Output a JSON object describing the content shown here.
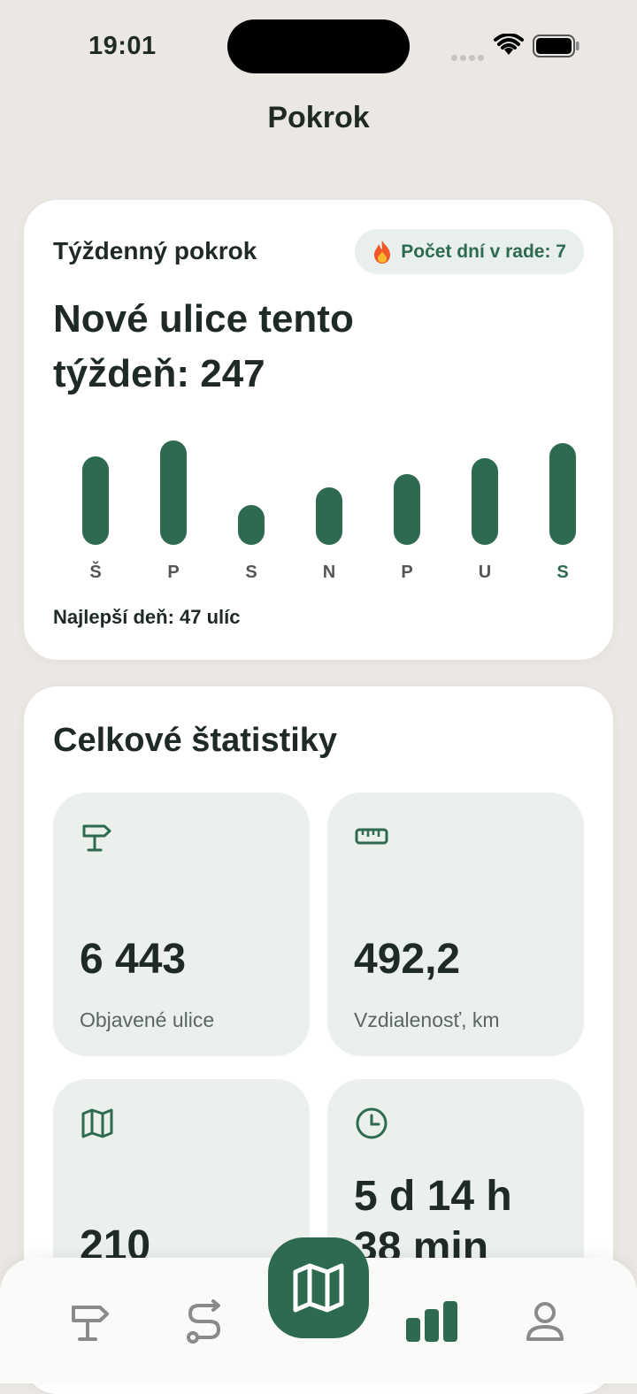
{
  "status_bar": {
    "time": "19:01"
  },
  "page": {
    "title": "Pokrok"
  },
  "weekly": {
    "label": "Týždenný pokrok",
    "streak_text": "Počet dní v rade: 7",
    "headline": "Nové ulice tento týždeň: 247",
    "best_day": "Najlepší deň: 47 ulíc"
  },
  "chart_data": {
    "type": "bar",
    "categories": [
      "Š",
      "P",
      "S",
      "N",
      "P",
      "U",
      "S"
    ],
    "values": [
      40,
      47,
      18,
      26,
      32,
      39,
      46
    ],
    "highlight_index": 6,
    "colors": {
      "bar": "#2d6a50",
      "label": "#555555",
      "highlight_label": "#2d6a50"
    }
  },
  "stats": {
    "title": "Celkové štatistiky",
    "tiles": [
      {
        "icon": "signpost-icon",
        "value": "6 443",
        "label": "Objavené ulice"
      },
      {
        "icon": "ruler-icon",
        "value": "492,2",
        "label": "Vzdialenosť, km"
      },
      {
        "icon": "map-icon",
        "value": "210",
        "label": ""
      },
      {
        "icon": "clock-icon",
        "value": "5 d 14 h 38 min",
        "label": ""
      }
    ]
  },
  "tabbar": {
    "items": [
      "signpost-icon",
      "route-icon",
      "map-icon",
      "stats-icon",
      "profile-icon"
    ],
    "active": "stats-icon"
  },
  "colors": {
    "accent": "#2d6a50",
    "background": "#ebe8e4",
    "tile": "#ebf0ed"
  }
}
